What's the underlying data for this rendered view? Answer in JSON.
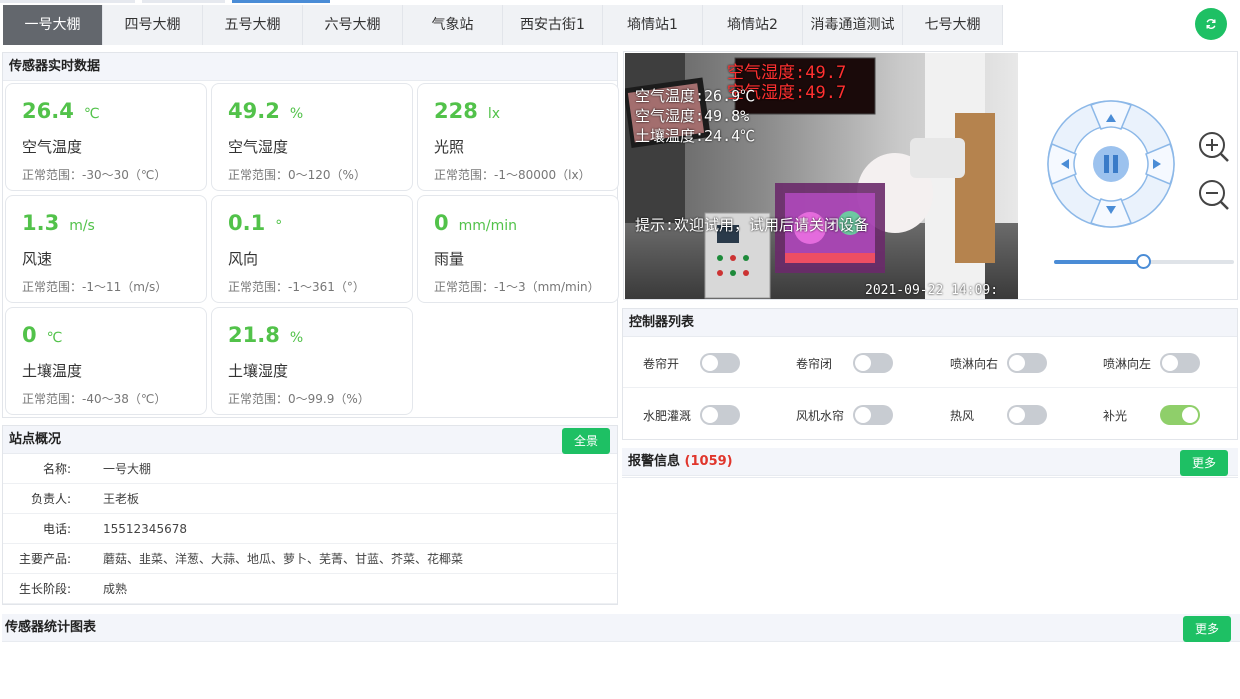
{
  "tabs": [
    "一号大棚",
    "四号大棚",
    "五号大棚",
    "六号大棚",
    "气象站",
    "西安古街1",
    "墒情站1",
    "墒情站2",
    "消毒通道测试",
    "七号大棚"
  ],
  "active_tab": "一号大棚",
  "sensor_panel": {
    "title": "传感器实时数据",
    "cards": [
      {
        "value": "26.4",
        "unit": "℃",
        "name": "空气温度",
        "range": "正常范围：-30～30（℃）"
      },
      {
        "value": "49.2",
        "unit": "%",
        "name": "空气湿度",
        "range": "正常范围：0～120（%）"
      },
      {
        "value": "228",
        "unit": "lx",
        "name": "光照",
        "range": "正常范围：-1～80000（lx）"
      },
      {
        "value": "1.3",
        "unit": "m/s",
        "name": "风速",
        "range": "正常范围：-1～11（m/s）"
      },
      {
        "value": "0.1",
        "unit": "°",
        "name": "风向",
        "range": "正常范围：-1～361（°）"
      },
      {
        "value": "0",
        "unit": "mm/min",
        "name": "雨量",
        "range": "正常范围：-1～3（mm/min）"
      },
      {
        "value": "0",
        "unit": "℃",
        "name": "土壤温度",
        "range": "正常范围：-40～38（℃）"
      },
      {
        "value": "21.8",
        "unit": "%",
        "name": "土壤湿度",
        "range": "正常范围：0～99.9（%）"
      }
    ]
  },
  "site_panel": {
    "title": "站点概况",
    "button": "全景",
    "rows": [
      {
        "key": "名称:",
        "value": "一号大棚"
      },
      {
        "key": "负责人:",
        "value": "王老板"
      },
      {
        "key": "电话:",
        "value": "15512345678"
      },
      {
        "key": "主要产品:",
        "value": "蘑菇、韭菜、洋葱、大蒜、地瓜、萝卜、芜菁、甘蓝、芥菜、花椰菜"
      },
      {
        "key": "生长阶段:",
        "value": "成熟"
      }
    ]
  },
  "video": {
    "osd_lines": [
      "空气温度:26.9℃",
      "空气湿度:49.8%",
      "土壤温度:24.4℃"
    ],
    "led_text": "空气湿度:49.7",
    "welcome": "提示:欢迎试用，试用后请关闭设备",
    "timestamp": "2021-09-22 14:09:"
  },
  "ptz": {
    "zoom_level": 0.5
  },
  "controllers": {
    "title": "控制器列表",
    "items": [
      {
        "label": "卷帘开",
        "on": false
      },
      {
        "label": "卷帘闭",
        "on": false
      },
      {
        "label": "喷淋向右",
        "on": false
      },
      {
        "label": "喷淋向左",
        "on": false
      },
      {
        "label": "水肥灌溉",
        "on": false
      },
      {
        "label": "风机水帘",
        "on": false
      },
      {
        "label": "热风",
        "on": false
      },
      {
        "label": "补光",
        "on": true
      }
    ]
  },
  "alarm": {
    "title": "报警信息",
    "count": "(1059)",
    "button": "更多"
  },
  "chart_section": {
    "title": "传感器统计图表",
    "button": "更多"
  },
  "colors": {
    "accent_green": "#1ec064",
    "value_green": "#52c24a",
    "active_tab": "#63676d",
    "alarm_red": "#e0362c",
    "ptz_blue": "#4a8cd6"
  }
}
